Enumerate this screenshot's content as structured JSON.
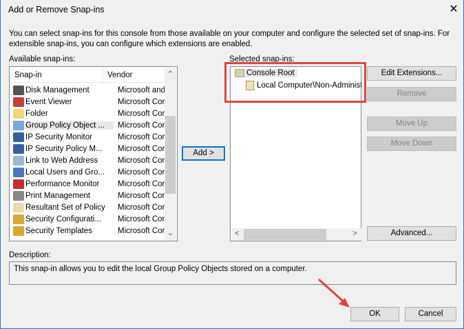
{
  "window": {
    "title": "Add or Remove Snap-ins",
    "close": "✕"
  },
  "intro": "You can select snap-ins for this console from those available on your computer and configure the selected set of snap-ins. For extensible snap-ins, you can configure which extensions are enabled.",
  "available": {
    "label": "Available snap-ins:",
    "columns": [
      "Snap-in",
      "Vendor"
    ],
    "items": [
      {
        "name": "Disk Management",
        "vendor": "Microsoft and...",
        "color": "#555"
      },
      {
        "name": "Event Viewer",
        "vendor": "Microsoft Cor...",
        "color": "#c04040"
      },
      {
        "name": "Folder",
        "vendor": "Microsoft Cor...",
        "color": "#f2d87a"
      },
      {
        "name": "Group Policy Object ...",
        "vendor": "Microsoft Cor...",
        "color": "#7aa6d8"
      },
      {
        "name": "IP Security Monitor",
        "vendor": "Microsoft Cor...",
        "color": "#3a5fa0"
      },
      {
        "name": "IP Security Policy M...",
        "vendor": "Microsoft Cor...",
        "color": "#3a5fa0"
      },
      {
        "name": "Link to Web Address",
        "vendor": "Microsoft Cor...",
        "color": "#9ab8d8"
      },
      {
        "name": "Local Users and Gro...",
        "vendor": "Microsoft Cor...",
        "color": "#4a7ac0"
      },
      {
        "name": "Performance Monitor",
        "vendor": "Microsoft Cor...",
        "color": "#c03030"
      },
      {
        "name": "Print Management",
        "vendor": "Microsoft Cor...",
        "color": "#888"
      },
      {
        "name": "Resultant Set of Policy",
        "vendor": "Microsoft Cor...",
        "color": "#e8dcb0"
      },
      {
        "name": "Security Configurati...",
        "vendor": "Microsoft Cor...",
        "color": "#d8a830"
      },
      {
        "name": "Security Templates",
        "vendor": "Microsoft Cor...",
        "color": "#d8a830"
      }
    ]
  },
  "add_label": "Add >",
  "selected": {
    "label": "Selected snap-ins:",
    "root": "Console Root",
    "child": "Local Computer\\Non-Administra"
  },
  "buttons": {
    "edit": "Edit Extensions...",
    "remove": "Remove",
    "up": "Move Up",
    "down": "Move Down",
    "advanced": "Advanced...",
    "ok": "OK",
    "cancel": "Cancel"
  },
  "description": {
    "label": "Description:",
    "text": "This snap-in allows you to edit the local Group Policy Objects stored on a computer."
  },
  "scroll": {
    "up": "⌃",
    "down": "⌄",
    "left": "<",
    "right": ">"
  }
}
